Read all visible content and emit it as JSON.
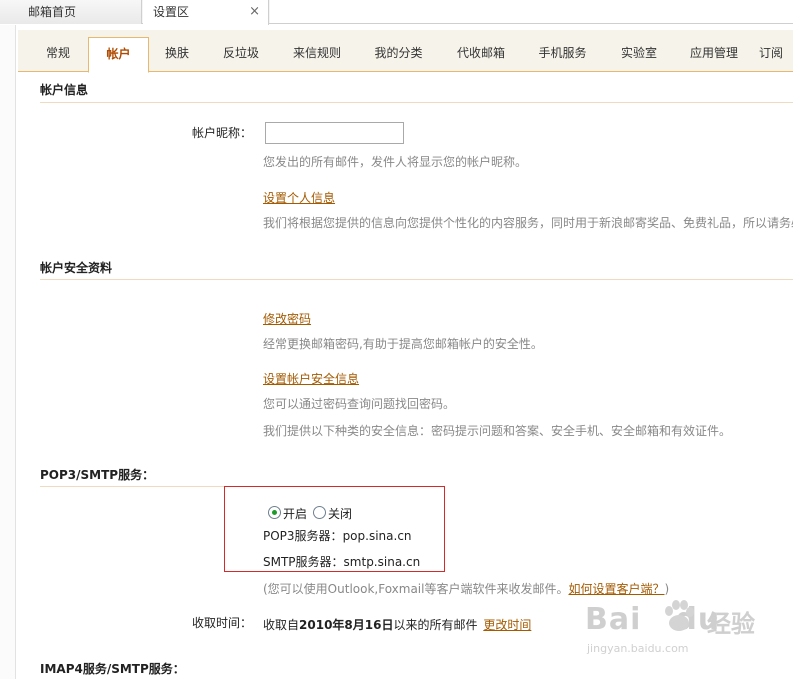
{
  "topbar": {
    "tabs": [
      {
        "label": "邮箱首页"
      },
      {
        "label": "设置区"
      }
    ],
    "close_glyph": "×"
  },
  "nav": {
    "tabs": [
      "常规",
      "帐户",
      "换肤",
      "反垃圾",
      "来信规则",
      "我的分类",
      "代收邮箱",
      "手机服务",
      "实验室",
      "应用管理",
      "订阅"
    ],
    "active_index": 1
  },
  "account_info": {
    "title": "帐户信息",
    "nickname_label": "帐户昵称：",
    "nickname_value": "",
    "nickname_hint": "您发出的所有邮件，发件人将显示您的帐户昵称。",
    "personal_link": "设置个人信息",
    "personal_hint": "我们将根据您提供的信息向您提供个性化的内容服务，同时用于新浪邮寄奖品、免费礼品，所以请务必"
  },
  "security": {
    "title": "帐户安全资料",
    "change_password_link": "修改密码",
    "change_password_hint": "经常更换邮箱密码,有助于提高您邮箱帐户的安全性。",
    "security_info_link": "设置帐户安全信息",
    "security_info_hint1": "您可以通过密码查询问题找回密码。",
    "security_info_hint2": "我们提供以下种类的安全信息：密码提示问题和答案、安全手机、安全邮箱和有效证件。"
  },
  "pop3": {
    "title": "POP3/SMTP服务：",
    "option_on": "开启",
    "option_off": "关闭",
    "selected": "开启",
    "pop3_label": "POP3服务器：",
    "pop3_server": "pop.sina.cn",
    "smtp_label": "SMTP服务器：",
    "smtp_server": "smtp.sina.cn",
    "client_hint": "(您可以使用Outlook,Foxmail等客户端软件来收发邮件。",
    "client_link": "如何设置客户端？",
    "client_hint_end": ")",
    "receive_label": "收取时间：",
    "receive_prefix": "收取自",
    "receive_date": "2010年8月16日",
    "receive_suffix": "以来的所有邮件",
    "change_time_link": "更改时间"
  },
  "imap": {
    "title": "IMAP4服务/SMTP服务："
  },
  "watermark": {
    "brand": "Bai",
    "brand2": "du",
    "jingyan": "经验",
    "url": "jingyan.baidu.com"
  }
}
